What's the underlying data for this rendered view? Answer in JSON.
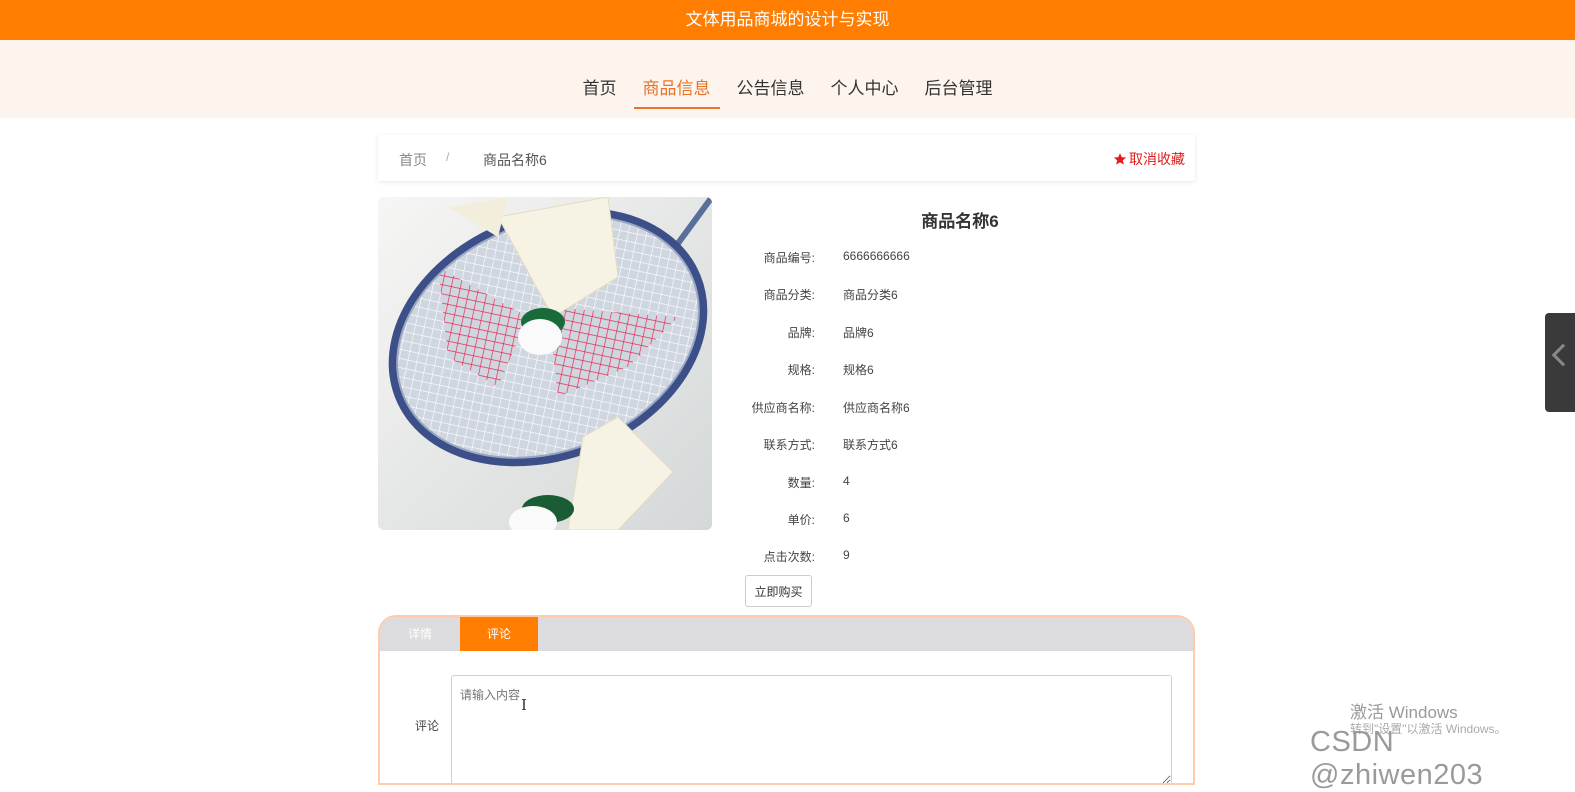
{
  "site": {
    "title": "文体用品商城的设计与实现"
  },
  "nav": {
    "items": [
      {
        "label": "首页"
      },
      {
        "label": "商品信息"
      },
      {
        "label": "公告信息"
      },
      {
        "label": "个人中心"
      },
      {
        "label": "后台管理"
      }
    ],
    "active_index": 1
  },
  "breadcrumb": {
    "home": "首页",
    "separator": "/",
    "current": "商品名称6"
  },
  "favorite": {
    "label": "取消收藏",
    "icon": "star-icon",
    "color": "#e11c1c"
  },
  "product": {
    "name": "商品名称6",
    "fields": [
      {
        "label": "商品编号:",
        "value": "6666666666"
      },
      {
        "label": "商品分类:",
        "value": "商品分类6"
      },
      {
        "label": "品牌:",
        "value": "品牌6"
      },
      {
        "label": "规格:",
        "value": "规格6"
      },
      {
        "label": "供应商名称:",
        "value": "供应商名称6"
      },
      {
        "label": "联系方式:",
        "value": "联系方式6"
      },
      {
        "label": "数量:",
        "value": "4"
      },
      {
        "label": "单价:",
        "value": "6"
      },
      {
        "label": "点击次数:",
        "value": "9"
      }
    ],
    "buy_label": "立即购买"
  },
  "tabs": {
    "items": [
      {
        "label": "详情"
      },
      {
        "label": "评论"
      }
    ],
    "active_index": 1
  },
  "comment": {
    "label": "评论",
    "placeholder": "请输入内容"
  },
  "overlay": {
    "activate_title": "激活 Windows",
    "activate_sub": "转到\"设置\"以激活 Windows。",
    "watermark": "CSDN @zhiwen203"
  },
  "colors": {
    "accent": "#ff7d00",
    "nav_active": "#e7742a"
  }
}
